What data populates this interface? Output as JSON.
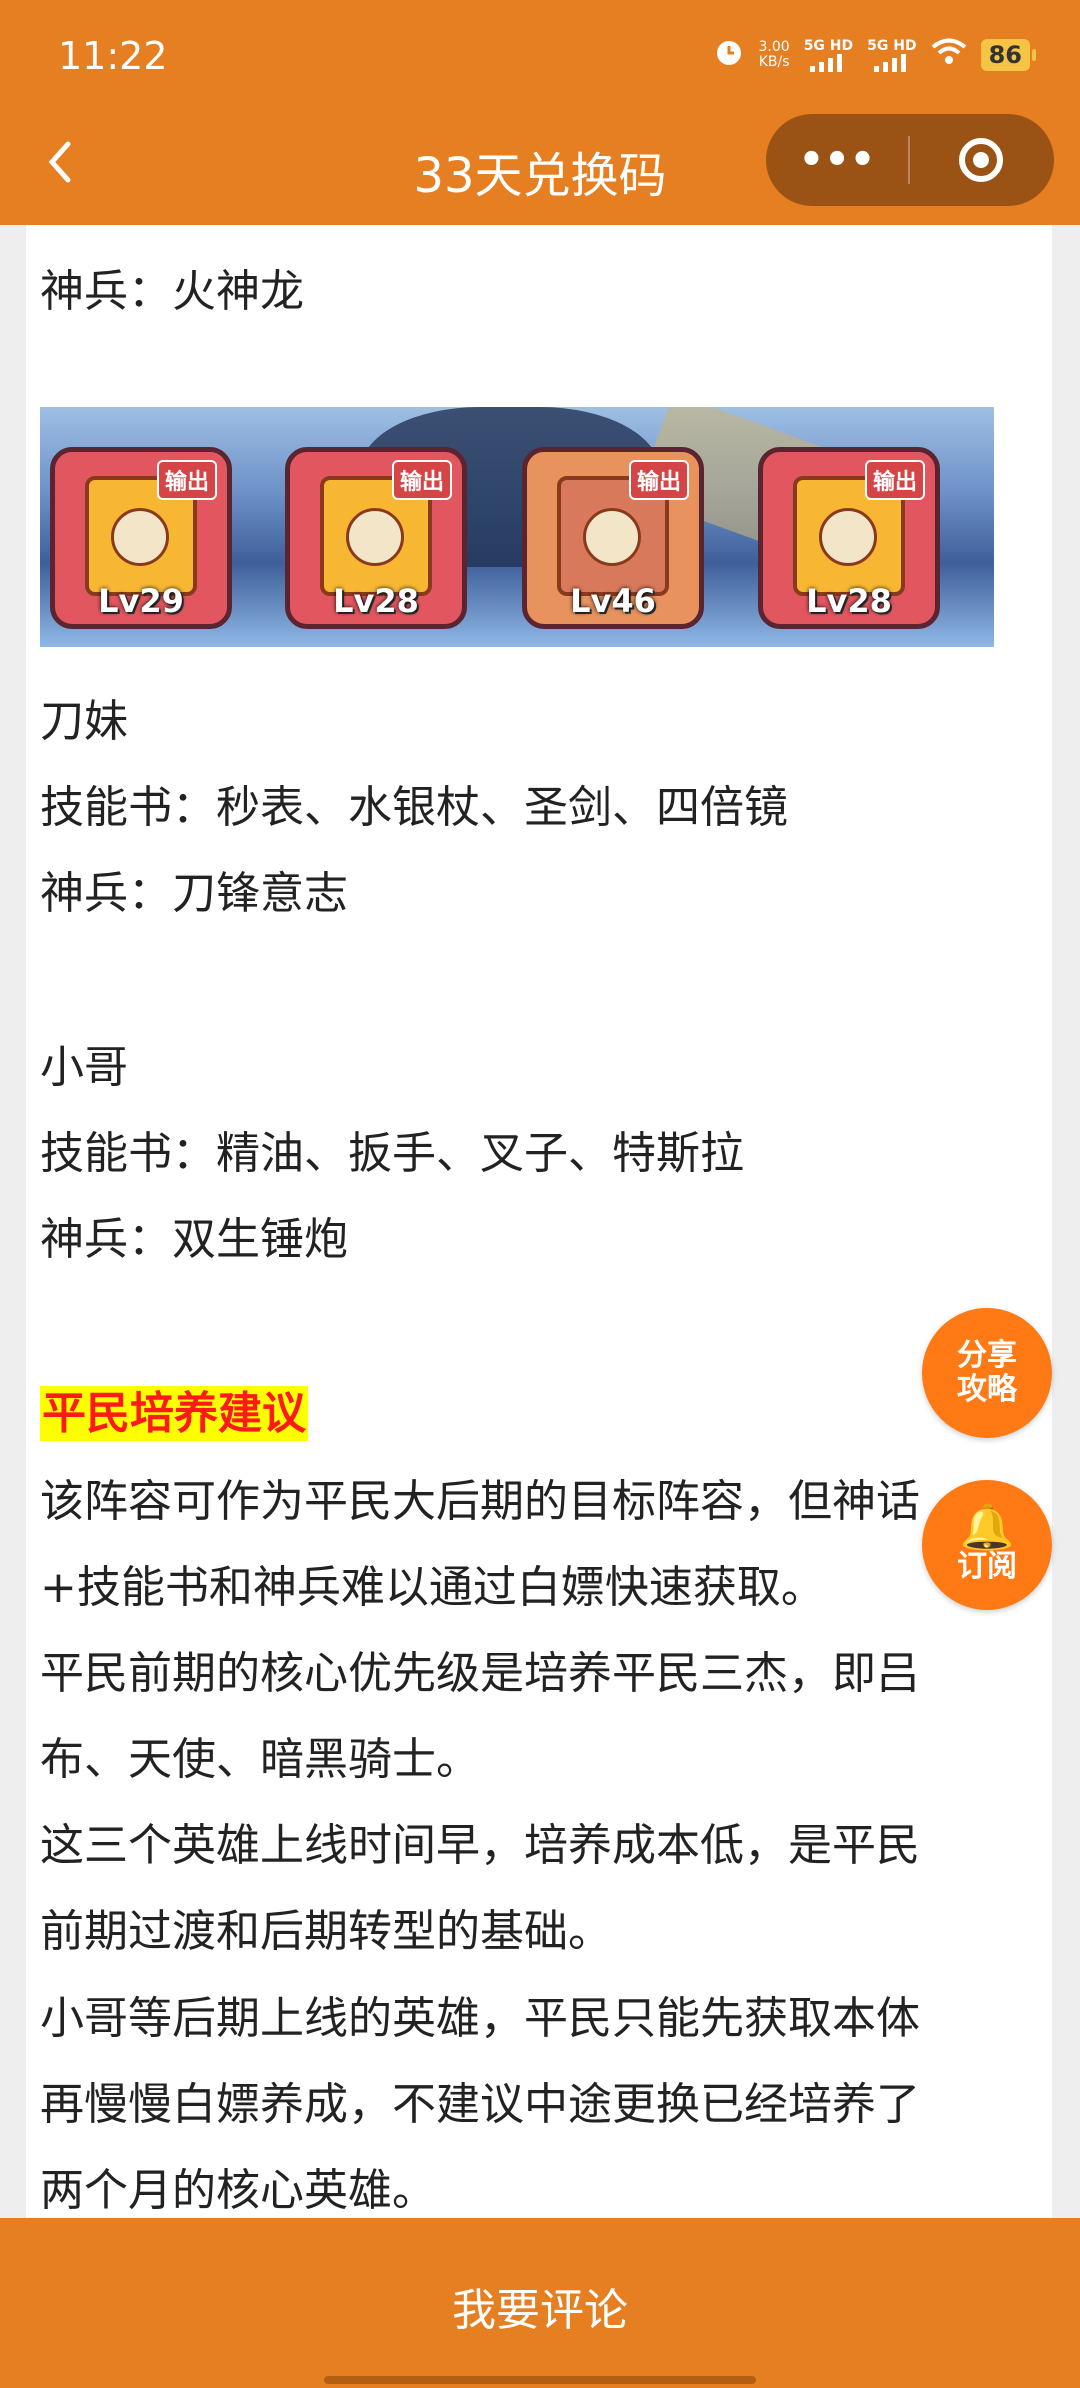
{
  "status_bar": {
    "time": "11:22",
    "net_speed": "3.00\nKB/s",
    "signal1": "5G HD",
    "signal2": "5G HD",
    "battery": "86"
  },
  "nav": {
    "title": "33天兑换码",
    "back_icon": "chevron-left-icon",
    "more_label": "•••",
    "target_icon": "target-icon"
  },
  "article": {
    "line_weapon_fire": "神兵：火神龙",
    "cards": [
      {
        "tag": "输出",
        "level": "Lv29"
      },
      {
        "tag": "输出",
        "level": "Lv28"
      },
      {
        "tag": "输出",
        "level": "Lv46"
      },
      {
        "tag": "输出",
        "level": "Lv28"
      }
    ],
    "hero1_name": "刀妹",
    "hero1_books": "技能书：秒表、水银杖、圣剑、四倍镜",
    "hero1_weapon": "神兵：刀锋意志",
    "hero2_name": "小哥",
    "hero2_books": "技能书：精油、扳手、叉子、特斯拉",
    "hero2_weapon": "神兵：双生锤炮",
    "section_heading": "平民培养建议",
    "para1_line1": "该阵容可作为平民大后期的目标阵容，但神话",
    "para1_line2": "+技能书和神兵难以通过白嫖快速获取。",
    "para2_line1": "平民前期的核心优先级是培养平民三杰，即吕",
    "para2_line2": "布、天使、暗黑骑士。",
    "para3_line1": "这三个英雄上线时间早，培养成本低，是平民",
    "para3_line2": "前期过渡和后期转型的基础。",
    "para4_line1": "小哥等后期上线的英雄，平民只能先获取本体",
    "para4_line2": "再慢慢白嫖养成，不建议中途更换已经培养了",
    "para4_line3": "两个月的核心英雄。"
  },
  "float": {
    "share_line1": "分享",
    "share_line2": "攻略",
    "subscribe_label": "订阅",
    "bell_icon": "bell-icon"
  },
  "bottom": {
    "comment_label": "我要评论"
  },
  "colors": {
    "brand_orange": "#e67e22",
    "float_orange": "#ff7a14",
    "heading_red": "#ff1a1a",
    "highlight_yellow": "#ffff00"
  }
}
